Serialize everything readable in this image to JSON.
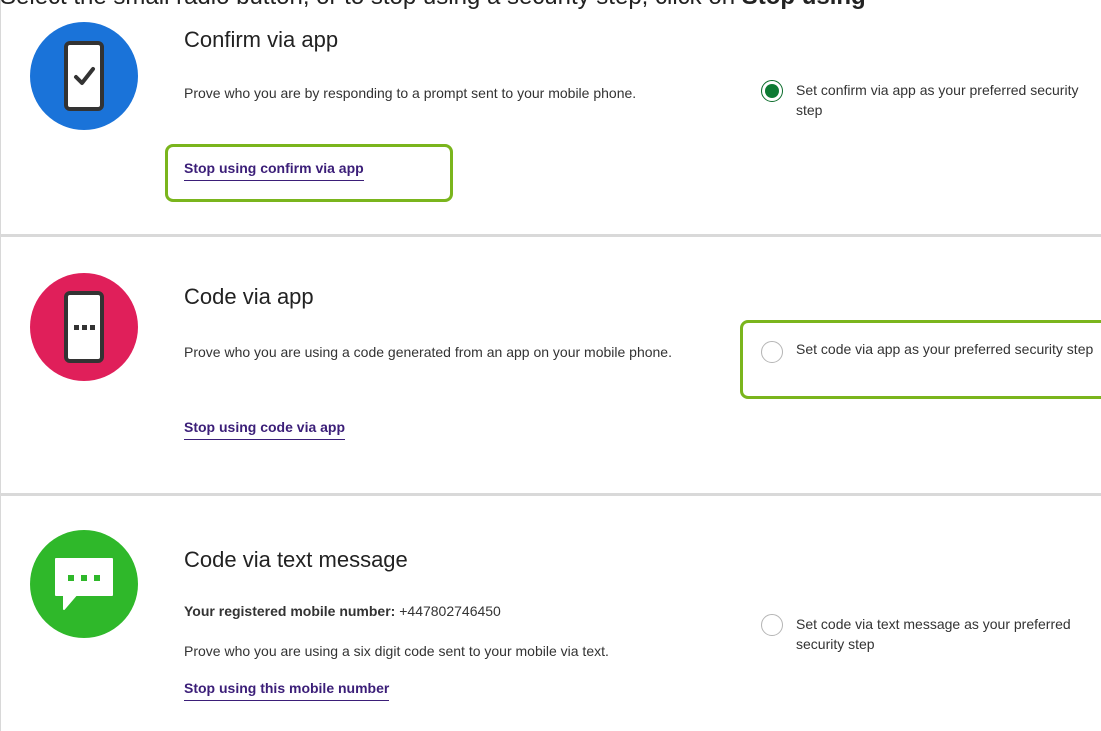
{
  "instruction": {
    "prefix": "Select the small radio button, or to stop using a security step, click on",
    "bold": "Stop using"
  },
  "colors": {
    "confirm_app": "#1a73d9",
    "code_app": "#e01f5a",
    "code_text": "#2fb82a",
    "link": "#3b1e78",
    "highlight": "#7ab51d",
    "radio_checked": "#0d7a33"
  },
  "methods": [
    {
      "icon": "phone-check-icon",
      "title": "Confirm via app",
      "description": "Prove who you are by responding to a prompt sent to your mobile phone.",
      "stop_label": "Stop using confirm via app",
      "radio_label": "Set confirm via app as your preferred security step",
      "selected": true
    },
    {
      "icon": "phone-dots-icon",
      "title": "Code via app",
      "description": "Prove who you are using a code generated from an app on your mobile phone.",
      "stop_label": "Stop using code via app",
      "radio_label": "Set code via app as your preferred security step",
      "selected": false
    },
    {
      "icon": "message-bubble-icon",
      "title": "Code via text message",
      "registered_label": "Your registered mobile number:",
      "registered_number": "+447802746450",
      "description": "Prove who you are using a six digit code sent to your mobile via text.",
      "stop_label": "Stop using this mobile number",
      "radio_label": "Set code via text message as your preferred security step",
      "selected": false
    }
  ]
}
